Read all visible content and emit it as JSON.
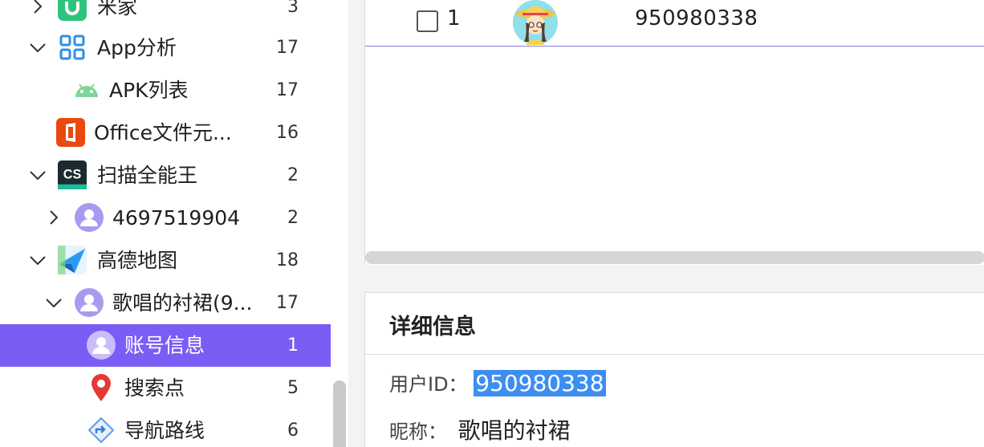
{
  "tree": {
    "items": [
      {
        "label": "米家",
        "count": "3"
      },
      {
        "label": "App分析",
        "count": "17"
      },
      {
        "label": "APK列表",
        "count": "17"
      },
      {
        "label": "Office文件元...",
        "count": "16"
      },
      {
        "label": "扫描全能王",
        "count": "2"
      },
      {
        "label": "4697519904",
        "count": "2"
      },
      {
        "label": "高德地图",
        "count": "18"
      },
      {
        "label": "歌唱的衬裙(9...",
        "count": "17"
      },
      {
        "label": "账号信息",
        "count": "1"
      },
      {
        "label": "搜索点",
        "count": "5"
      },
      {
        "label": "导航路线",
        "count": "6"
      }
    ],
    "selected_index": 8,
    "icon_cs_text": "CS"
  },
  "table": {
    "rows": [
      {
        "index": "1",
        "user_id": "950980338"
      }
    ]
  },
  "detail": {
    "title": "详细信息",
    "fields": [
      {
        "key": "用户ID：",
        "value": "950980338"
      },
      {
        "key": "昵称：",
        "value": "歌唱的衬裙"
      }
    ]
  },
  "colors": {
    "selected_bg": "#7b5cf5",
    "selection_highlight": "#3d8ef0",
    "row_separator": "#8b7fe0"
  }
}
